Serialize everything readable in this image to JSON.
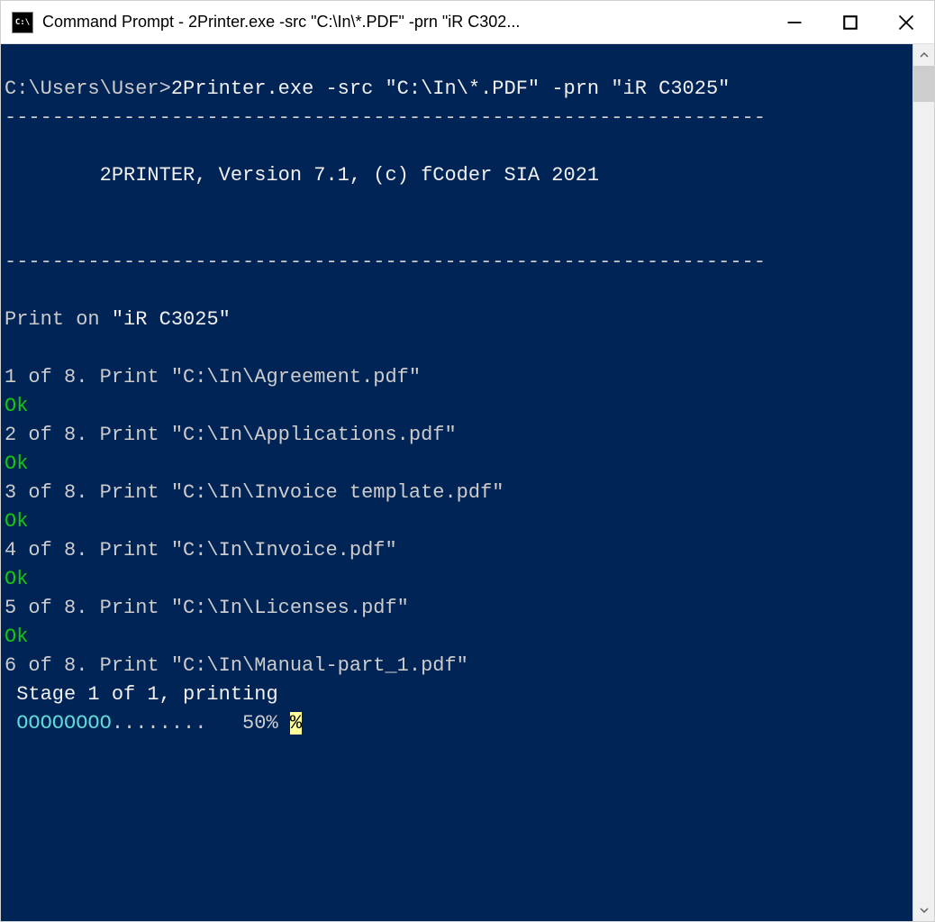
{
  "window": {
    "icon_label": "C:\\",
    "title": "Command Prompt - 2Printer.exe  -src \"C:\\In\\*.PDF\" -prn \"iR C302..."
  },
  "terminal": {
    "prompt": "C:\\Users\\User>",
    "command": "2Printer.exe -src \"C:\\In\\*.PDF\" -prn \"iR C3025\"",
    "hr": "----------------------------------------------------------------",
    "banner": "        2PRINTER, Version 7.1, (c) fCoder SIA 2021",
    "print_on_label": "Print on ",
    "print_on_target": "\"iR C3025\"",
    "jobs": [
      {
        "line": "1 of 8. Print \"C:\\In\\Agreement.pdf\"",
        "ok": "Ok"
      },
      {
        "line": "2 of 8. Print \"C:\\In\\Applications.pdf\"",
        "ok": "Ok"
      },
      {
        "line": "3 of 8. Print \"C:\\In\\Invoice template.pdf\"",
        "ok": "Ok"
      },
      {
        "line": "4 of 8. Print \"C:\\In\\Invoice.pdf\"",
        "ok": "Ok"
      },
      {
        "line": "5 of 8. Print \"C:\\In\\Licenses.pdf\"",
        "ok": "Ok"
      }
    ],
    "current_job": "6 of 8. Print \"C:\\In\\Manual-part_1.pdf\"",
    "stage": " Stage 1 of 1, printing",
    "progress_left": " ",
    "progress_bar": "OOOOOOOO",
    "progress_dots": "........   50% ",
    "progress_highlight": "%"
  }
}
